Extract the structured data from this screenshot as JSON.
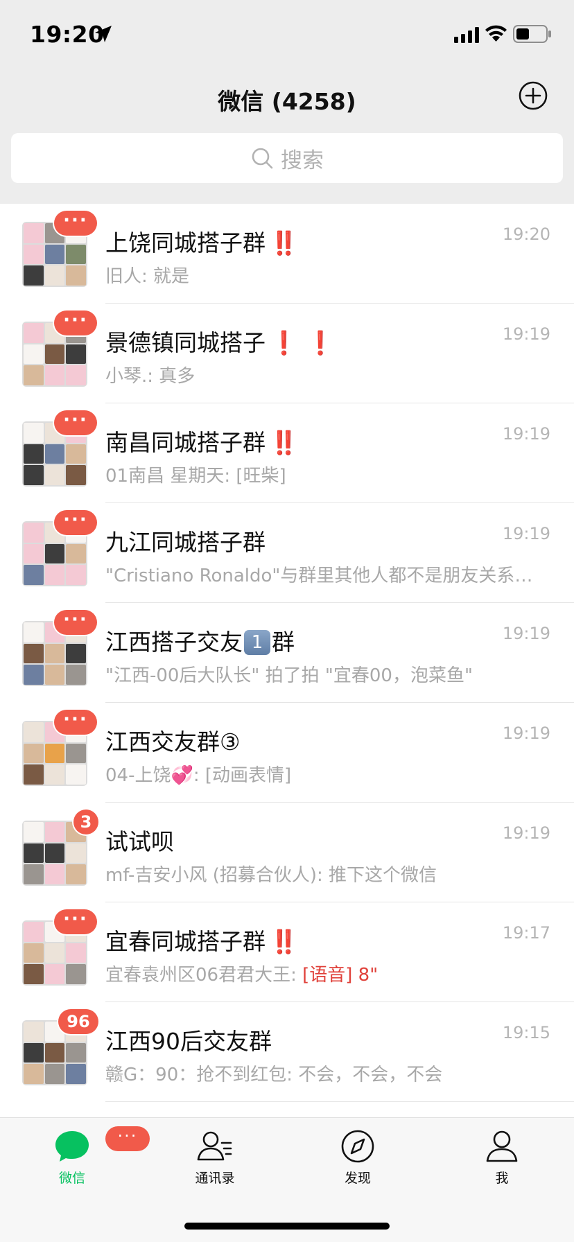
{
  "status_bar": {
    "time": "19:20"
  },
  "header": {
    "title": "微信 (4258)"
  },
  "search": {
    "placeholder": "搜索"
  },
  "chats": [
    {
      "name": "上饶同城搭子群",
      "alert": "‼️",
      "time": "19:20",
      "preview": "旧人: 就是",
      "badge": "···"
    },
    {
      "name": "景德镇同城搭子",
      "alert": "❗ ❗",
      "time": "19:19",
      "preview": "小琴.: 真多",
      "badge": "···"
    },
    {
      "name": "南昌同城搭子群",
      "alert": "‼️",
      "time": "19:19",
      "preview": "01南昌  星期天: [旺柴]",
      "badge": "···"
    },
    {
      "name": "九江同城搭子群",
      "alert": "",
      "time": "19:19",
      "preview": "\"Cristiano Ronaldo\"与群里其他人都不是朋友关系，请注意隐私安全",
      "badge": "···"
    },
    {
      "name_prefix": "江西搭子交友",
      "keycap": "1",
      "name_suffix": "群",
      "time": "19:19",
      "preview": "\"江西-00后大队长\" 拍了拍 \"宜春00，泡菜鱼\"",
      "badge": "···"
    },
    {
      "name": "江西交友群③",
      "alert": "",
      "time": "19:19",
      "preview_prefix": "04-上饶",
      "preview_emoji": "💞",
      "preview_suffix": ": [动画表情]",
      "badge": "···"
    },
    {
      "name": "试试呗",
      "alert": "",
      "time": "19:19",
      "preview": "mf-吉安小风 (招募合伙人): 推下这个微信",
      "badge": "3"
    },
    {
      "name": "宜春同城搭子群",
      "alert": "‼️",
      "time": "19:17",
      "preview_prefix": "宜春袁州区06君君大王: ",
      "preview_voice": "[语音] 8\"",
      "badge": "···"
    },
    {
      "name": "江西90后交友群",
      "alert": "",
      "time": "19:15",
      "preview": "赣G：90：抢不到红包: 不会，不会，不会",
      "badge": "96"
    }
  ],
  "tabs": [
    {
      "label": "微信",
      "icon": "chat-bubble-icon",
      "active": true,
      "badge": "···"
    },
    {
      "label": "通讯录",
      "icon": "contacts-icon",
      "active": false
    },
    {
      "label": "发现",
      "icon": "compass-icon",
      "active": false
    },
    {
      "label": "我",
      "icon": "person-icon",
      "active": false
    }
  ],
  "colors": {
    "accent": "#07c160",
    "badge": "#f15a4a",
    "alert": "#e0281f",
    "background": "#ededed"
  }
}
